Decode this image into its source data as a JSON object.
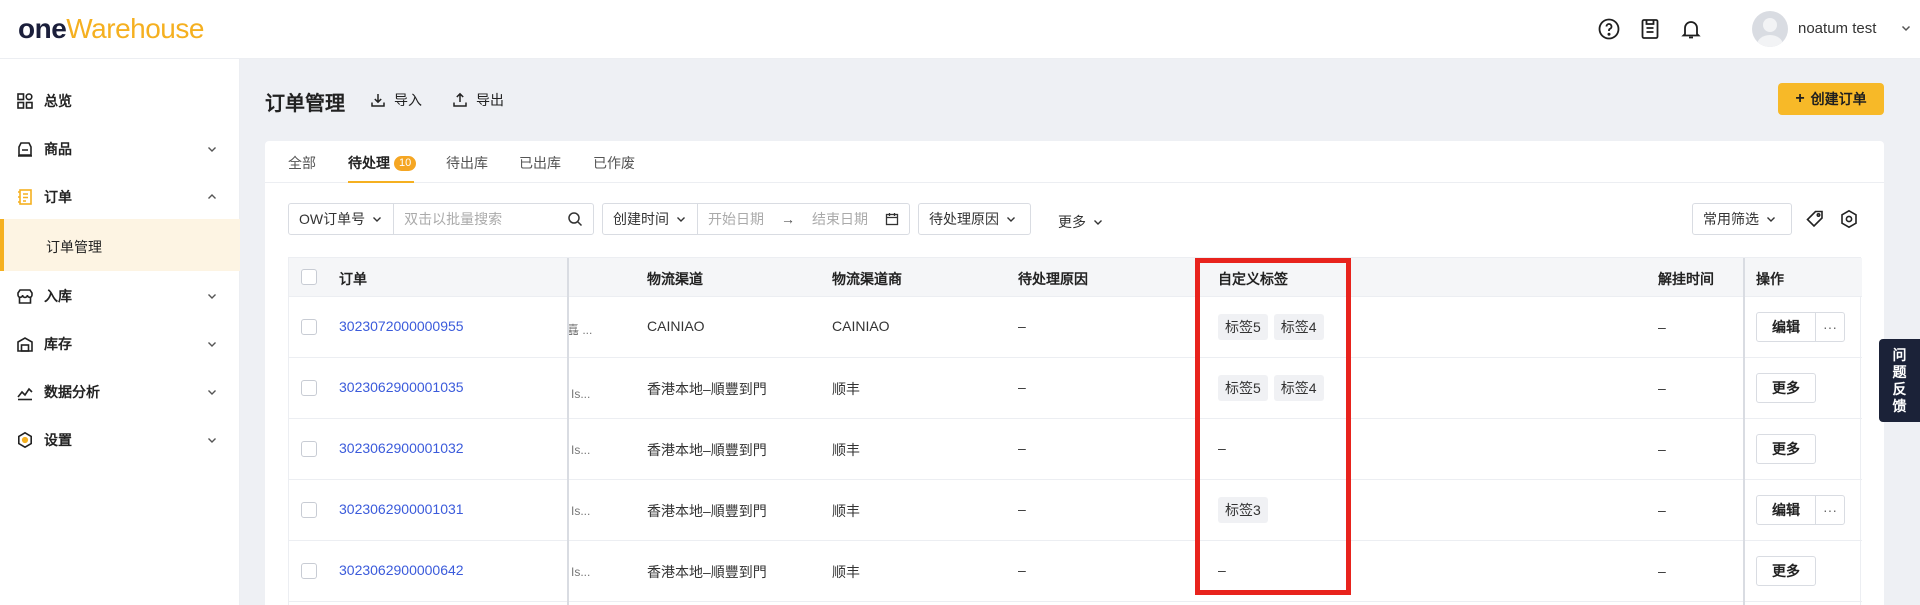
{
  "logo": {
    "part1": "one",
    "part2": "Warehouse"
  },
  "header": {
    "username": "noatum test",
    "icons": [
      "help-icon",
      "clipboard-icon",
      "bell-icon"
    ]
  },
  "sidebar": {
    "items": [
      {
        "label": "总览",
        "icon": "dashboard-icon"
      },
      {
        "label": "商品",
        "icon": "product-icon"
      },
      {
        "label": "订单",
        "icon": "order-icon",
        "expanded": true
      },
      {
        "label": "入库",
        "icon": "inbound-icon"
      },
      {
        "label": "库存",
        "icon": "inventory-icon"
      },
      {
        "label": "数据分析",
        "icon": "analytics-icon"
      },
      {
        "label": "设置",
        "icon": "settings-icon"
      }
    ],
    "sub_item": "订单管理",
    "accent": "#f5b020"
  },
  "page": {
    "title": "订单管理",
    "import_label": "导入",
    "export_label": "导出",
    "create_label": "创建订单"
  },
  "tabs": [
    {
      "label": "全部"
    },
    {
      "label": "待处理",
      "badge": "10",
      "active": true
    },
    {
      "label": "待出库"
    },
    {
      "label": "已出库"
    },
    {
      "label": "已作废"
    }
  ],
  "filters": {
    "order_select": "OW订单号",
    "search_placeholder": "双击以批量搜索",
    "time_select": "创建时间",
    "start_placeholder": "开始日期",
    "arrow": "→",
    "end_placeholder": "结束日期",
    "reason_select": "待处理原因",
    "more_label": "更多",
    "common_filter": "常用筛选"
  },
  "table": {
    "headers": {
      "order": "订单",
      "channel": "物流渠道",
      "carrier": "物流渠道商",
      "reason": "待处理原因",
      "tags": "自定义标签",
      "unhold_time": "解挂时间",
      "ops": "操作"
    },
    "rows": [
      {
        "order": "3023072000000955",
        "trunc": "嚞 ...",
        "channel": "CAINIAO",
        "carrier": "CAINIAO",
        "reason": "–",
        "tags": [
          "标签5",
          "标签4"
        ],
        "unhold": "–",
        "ops": "编辑",
        "has_more": true
      },
      {
        "order": "3023062900001035",
        "trunc": "Is...",
        "channel": "香港本地–順豐到門",
        "carrier": "顺丰",
        "reason": "–",
        "tags": [
          "标签5",
          "标签4"
        ],
        "unhold": "–",
        "ops": "更多",
        "has_more": false
      },
      {
        "order": "3023062900001032",
        "trunc": "Is...",
        "channel": "香港本地–順豐到門",
        "carrier": "顺丰",
        "reason": "–",
        "tags": [],
        "tags_empty": "–",
        "unhold": "–",
        "ops": "更多",
        "has_more": false
      },
      {
        "order": "3023062900001031",
        "trunc": "Is...",
        "channel": "香港本地–順豐到門",
        "carrier": "顺丰",
        "reason": "–",
        "tags": [
          "标签3"
        ],
        "unhold": "–",
        "ops": "编辑",
        "has_more": true
      },
      {
        "order": "3023062900000642",
        "trunc": "Is...",
        "channel": "香港本地–順豐到門",
        "carrier": "顺丰",
        "reason": "–",
        "tags": [],
        "tags_empty": "–",
        "unhold": "–",
        "ops": "更多",
        "has_more": false
      }
    ],
    "more_dots": "···"
  },
  "feedback": {
    "chars": [
      "问",
      "题",
      "反",
      "馈"
    ]
  },
  "highlight_color": "#e8231d"
}
